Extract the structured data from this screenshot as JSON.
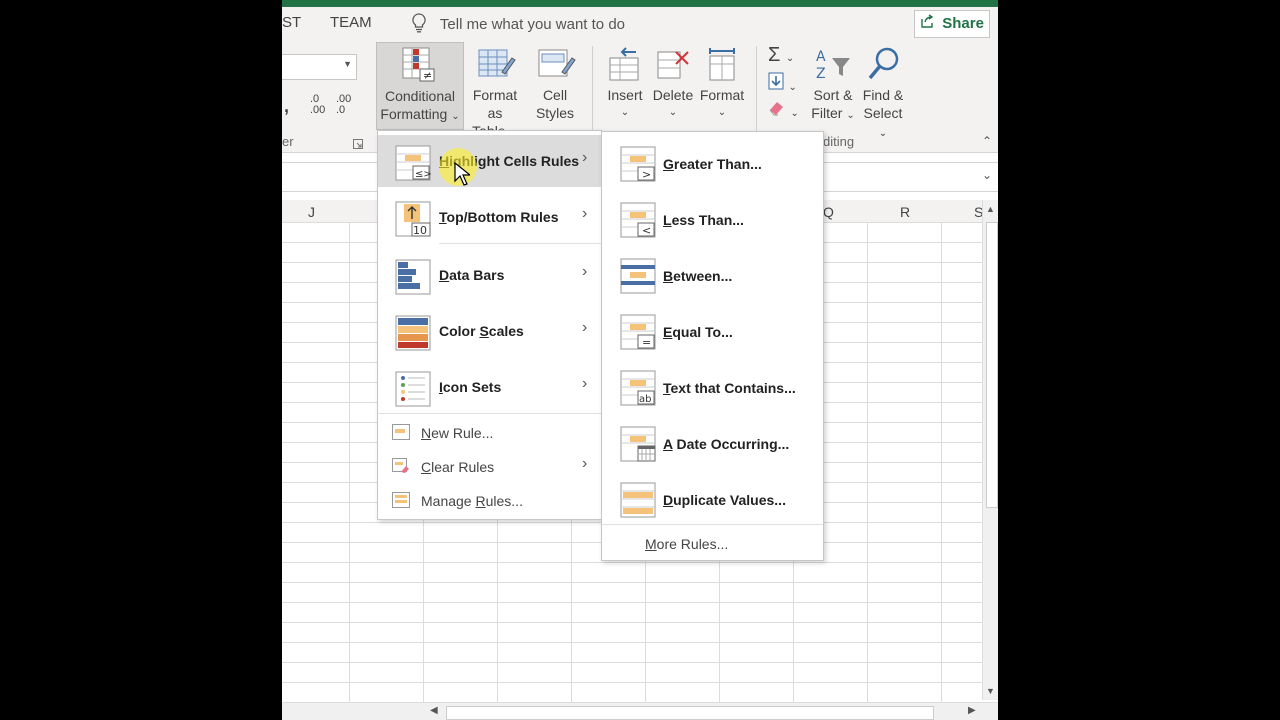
{
  "tabs": {
    "partial": "ST",
    "team": "TEAM"
  },
  "tell_me": {
    "placeholder": "Tell me what you want to do"
  },
  "share": {
    "label": "Share"
  },
  "ribbon": {
    "number_group_partial": "er",
    "editing_group_partial": "diting",
    "conditional_formatting": {
      "line1": "Conditional",
      "line2": "Formatting"
    },
    "format_as_table": {
      "line1": "Format as",
      "line2": "Table"
    },
    "cell_styles": {
      "line1": "Cell",
      "line2": "Styles"
    },
    "insert": {
      "line1": "Insert"
    },
    "delete": {
      "line1": "Delete"
    },
    "format": {
      "line1": "Format"
    },
    "sort_filter": {
      "line1": "Sort &",
      "line2": "Filter"
    },
    "find_select": {
      "line1": "Find &",
      "line2": "Select"
    },
    "inc_decimal": ".0\n.00",
    "dec_decimal": ".00\n.0",
    "comma": ","
  },
  "columns": {
    "j": "J",
    "q": "Q",
    "r": "R",
    "s": "S"
  },
  "menu": {
    "items": [
      {
        "pre": "",
        "u": "H",
        "post": "ighlight Cells Rules",
        "highlighted": true
      },
      {
        "pre": "",
        "u": "T",
        "post": "op/Bottom Rules",
        "highlighted": false
      },
      {
        "pre": "",
        "u": "D",
        "post": "ata Bars",
        "highlighted": false
      },
      {
        "pre": "Color ",
        "u": "S",
        "post": "cales",
        "highlighted": false
      },
      {
        "pre": "",
        "u": "I",
        "post": "con Sets",
        "highlighted": false
      }
    ],
    "small": [
      {
        "pre": "",
        "u": "N",
        "post": "ew Rule..."
      },
      {
        "pre": "",
        "u": "C",
        "post": "lear Rules"
      },
      {
        "pre": "Manage ",
        "u": "R",
        "post": "ules..."
      }
    ]
  },
  "submenu": {
    "items": [
      {
        "pre": "",
        "u": "G",
        "post": "reater Than..."
      },
      {
        "pre": "",
        "u": "L",
        "post": "ess Than..."
      },
      {
        "pre": "",
        "u": "B",
        "post": "etween..."
      },
      {
        "pre": "",
        "u": "E",
        "post": "qual To..."
      },
      {
        "pre": "",
        "u": "T",
        "post": "ext that Contains..."
      },
      {
        "pre": "",
        "u": "A",
        "post": " Date Occurring..."
      },
      {
        "pre": "",
        "u": "D",
        "post": "uplicate Values..."
      }
    ],
    "more": {
      "pre": "",
      "u": "M",
      "post": "ore Rules..."
    }
  },
  "colors": {
    "excel_green": "#217346",
    "highlight_bar": "#f5c27a",
    "data_bar_blue": "#4a6fa5"
  }
}
